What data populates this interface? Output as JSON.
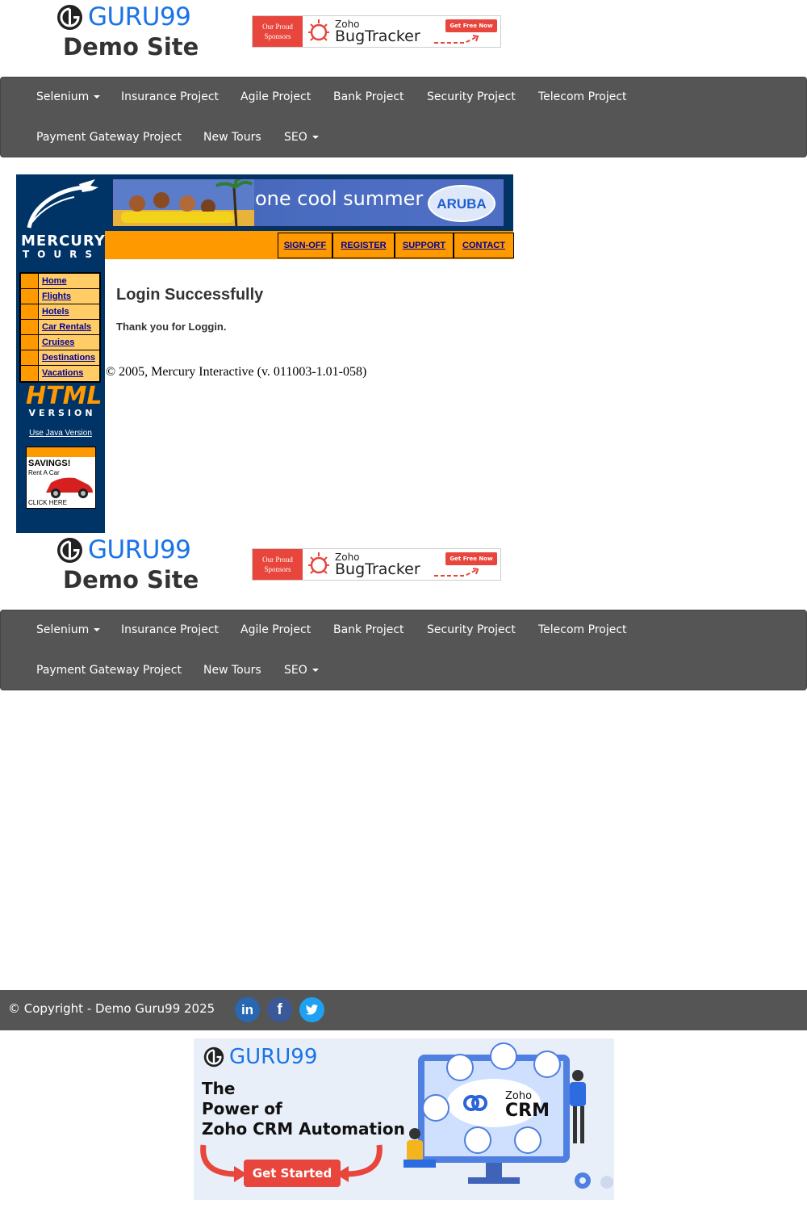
{
  "header": {
    "brand": "GURU99",
    "subtitle": "Demo Site",
    "sponsor": {
      "left_line1": "Our Proud",
      "left_line2": "Sponsors",
      "zoho": "Zoho",
      "product": "BugTracker",
      "cta": "Get Free Now"
    }
  },
  "nav": {
    "row1": [
      {
        "label": "Selenium",
        "dropdown": true
      },
      {
        "label": "Insurance Project"
      },
      {
        "label": "Agile Project"
      },
      {
        "label": "Bank Project"
      },
      {
        "label": "Security Project"
      },
      {
        "label": "Telecom Project"
      }
    ],
    "row2": [
      {
        "label": "Payment Gateway Project"
      },
      {
        "label": "New Tours"
      },
      {
        "label": "SEO",
        "dropdown": true
      }
    ]
  },
  "mercury": {
    "logo_word1": "MERCURY",
    "logo_word2": "TOURS",
    "banner_text": "one cool summer",
    "banner_badge": "ARUBA",
    "top_links": [
      "SIGN-OFF",
      "REGISTER",
      "SUPPORT",
      "CONTACT"
    ],
    "menu": [
      "Home",
      "Flights",
      "Hotels",
      "Car Rentals",
      "Cruises",
      "Destinations",
      "Vacations"
    ],
    "html_version_word1": "HTML",
    "html_version_word2": "VERSION",
    "java_link": "Use Java Version",
    "ad_title": "SAVINGS!",
    "ad_sub": "Rent A Car",
    "ad_cta": "CLICK HERE"
  },
  "content": {
    "title": "Login Successfully",
    "subtitle": "Thank you for Loggin.",
    "copyright": "© 2005, Mercury Interactive (v. 011003-1.01-058)"
  },
  "footer": {
    "text": "© Copyright - Demo Guru99 2025",
    "social": [
      "in",
      "f",
      "t"
    ]
  },
  "crm_ad": {
    "brand": "GURU99",
    "line1": "The",
    "line2": "Power of",
    "line3": "Zoho CRM Automation",
    "cta": "Get Started",
    "zoho": "Zoho",
    "crm": "CRM"
  },
  "colors": {
    "nav_bg": "#555555",
    "brand_blue": "#1a73e8",
    "mercury_navy": "#003366",
    "mercury_orange": "#ff9900",
    "link_blue": "#000099",
    "zoho_red": "#e8453c"
  }
}
